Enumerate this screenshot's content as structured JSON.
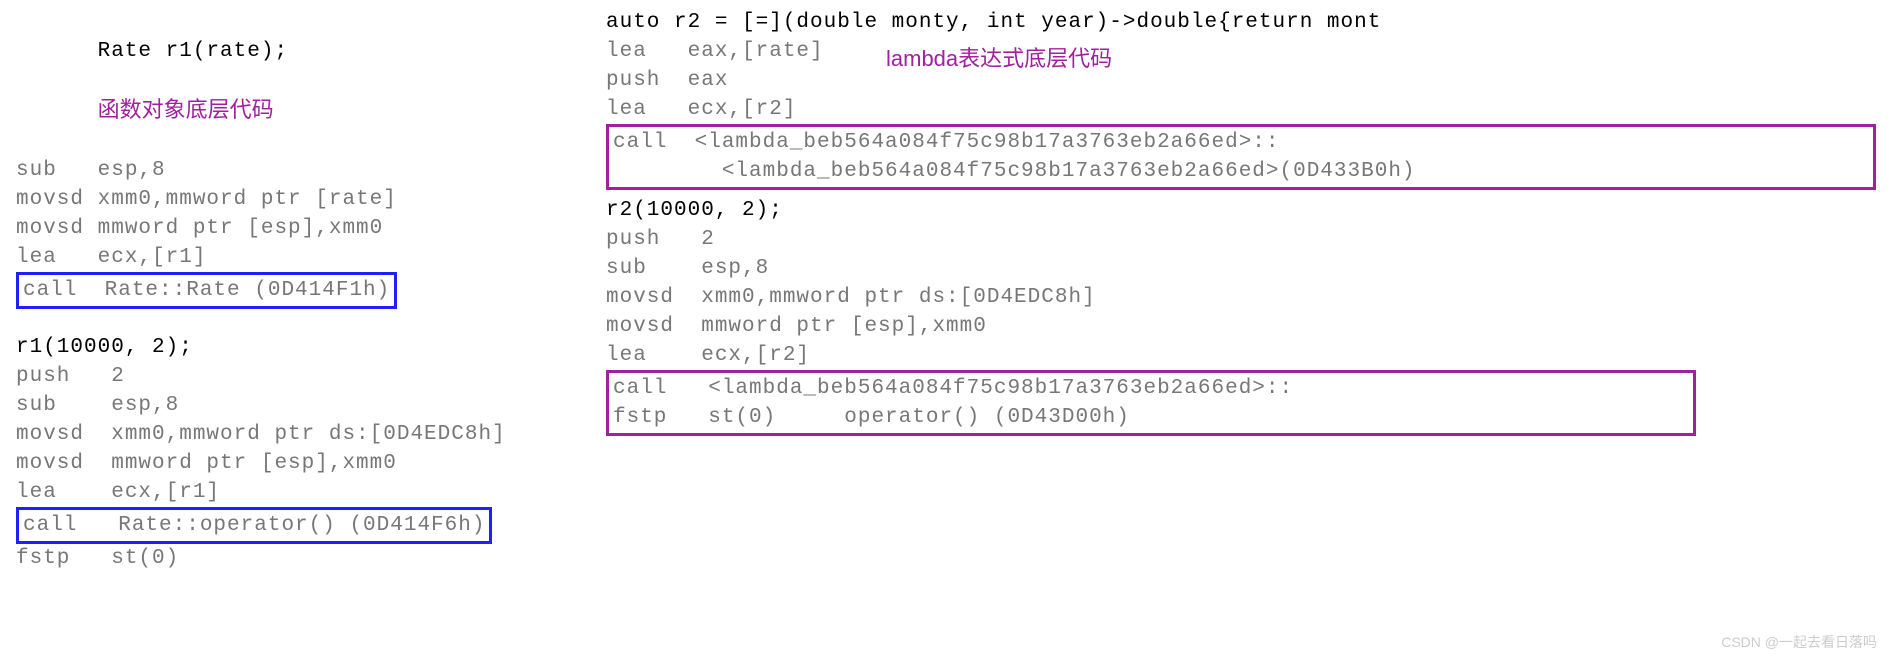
{
  "left": {
    "annot": "函数对象底层代码",
    "block1": {
      "src": "Rate r1(rate);",
      "asm": [
        "sub   esp,8",
        "movsd xmm0,mmword ptr [rate]",
        "movsd mmword ptr [esp],xmm0",
        "lea   ecx,[r1]"
      ],
      "call": "call  Rate::Rate (0D414F1h)"
    },
    "block2": {
      "src": "r1(10000, 2);",
      "asm": [
        "push   2",
        "sub    esp,8",
        "movsd  xmm0,mmword ptr ds:[0D4EDC8h]",
        "movsd  mmword ptr [esp],xmm0",
        "lea    ecx,[r1]"
      ],
      "call": "call   Rate::operator() (0D414F6h)",
      "tail": "fstp   st(0)"
    }
  },
  "right": {
    "annot": "lambda表达式底层代码",
    "block1": {
      "src": "auto r2 = [=](double monty, int year)->double{return mont",
      "asm": [
        "lea   eax,[rate]",
        "push  eax",
        "lea   ecx,[r2]"
      ],
      "call1": "call  <lambda_beb564a084f75c98b17a3763eb2a66ed>::",
      "call2": "        <lambda_beb564a084f75c98b17a3763eb2a66ed>(0D433B0h)"
    },
    "block2": {
      "src": "r2(10000, 2);",
      "asm": [
        "push   2",
        "sub    esp,8",
        "movsd  xmm0,mmword ptr ds:[0D4EDC8h]",
        "movsd  mmword ptr [esp],xmm0",
        "lea    ecx,[r2]"
      ],
      "call1": "call   <lambda_beb564a084f75c98b17a3763eb2a66ed>::",
      "call2": "fstp   st(0)     operator() (0D43D00h)"
    }
  },
  "watermark": "CSDN @一起去看日落吗"
}
